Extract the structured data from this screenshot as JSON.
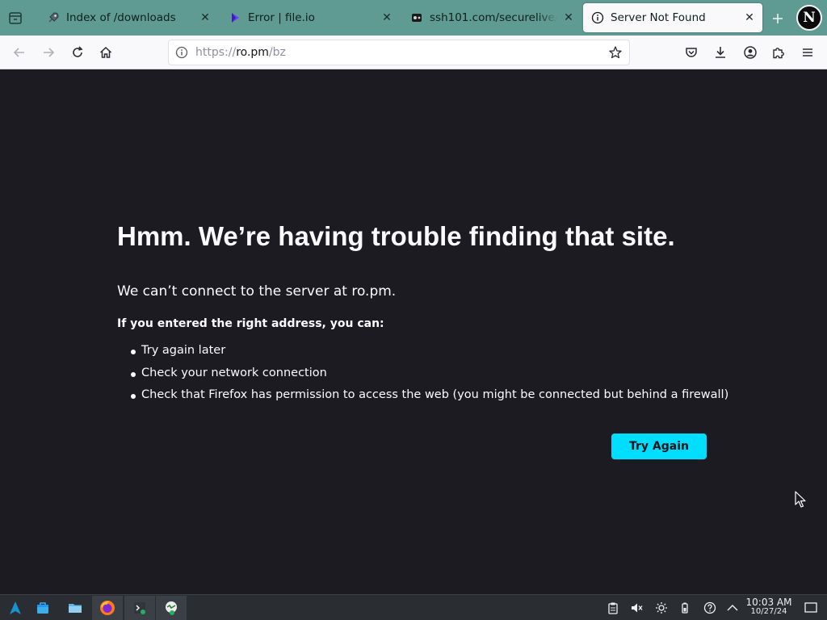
{
  "tabs": [
    {
      "title": "Index of /downloads",
      "icon": "rocket-icon",
      "active": false
    },
    {
      "title": "Error | file.io",
      "icon": "fileio-icon",
      "active": false
    },
    {
      "title": "ssh101.com/securelive/ind",
      "icon": "ssh101-icon",
      "active": false
    },
    {
      "title": "Server Not Found",
      "icon": "info-icon",
      "active": true
    }
  ],
  "url": {
    "prefix": "https://",
    "host": "ro.pm",
    "path": "/bz"
  },
  "profile": {
    "initial": "N"
  },
  "error": {
    "title": "Hmm. We’re having trouble finding that site.",
    "short_desc": "We can’t connect to the server at ro.pm.",
    "list_label": "If you entered the right address, you can:",
    "suggestions": [
      "Try again later",
      "Check your network connection",
      "Check that Firefox has permission to access the web (you might be connected but behind a firewall)"
    ],
    "button": "Try Again"
  },
  "taskbar": {
    "apps": [
      "app-launcher-icon",
      "discover-icon",
      "file-manager-icon",
      "firefox-icon",
      "terminal-icon",
      "network-app-icon"
    ],
    "tray": [
      "clipboard-icon",
      "volume-muted-icon",
      "brightness-icon",
      "battery-icon",
      "help-icon",
      "show-hidden-icon"
    ],
    "clock": {
      "time": "10:03 AM",
      "date": "10/27/24"
    }
  },
  "colors": {
    "tabstrip": "#5f9b92",
    "page_bg": "#1c1b22",
    "accent": "#00ddff",
    "taskbar": "#2a2e32"
  }
}
